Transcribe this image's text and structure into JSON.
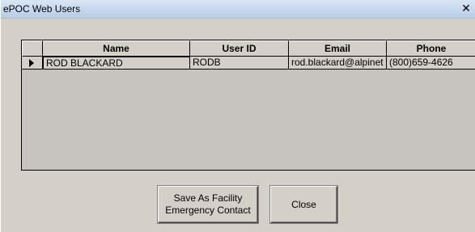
{
  "window": {
    "title": "ePOC Web Users",
    "close_label": "✕"
  },
  "grid": {
    "columns": [
      "Name",
      "User ID",
      "Email",
      "Phone"
    ],
    "rows": [
      {
        "indicator": "current-row",
        "name": "ROD BLACKARD",
        "user_id": "RODB",
        "email": "rod.blackard@alpinet",
        "phone": "(800)659-4626"
      }
    ]
  },
  "buttons": {
    "save_label": "Save As Facility\nEmergency Contact",
    "close_label": "Close"
  },
  "colors": {
    "dialog_background": "#d4d0c8",
    "grid_background": "#c6c3bd",
    "titlebar": "#c9daf0"
  },
  "icons": {
    "close": "close-icon",
    "row_indicator": "row-pointer-icon"
  }
}
